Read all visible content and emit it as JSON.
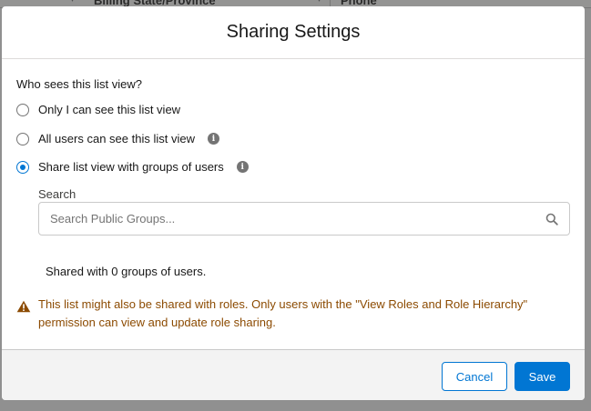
{
  "background": {
    "columns": [
      "Billing State/Province",
      "Phone"
    ]
  },
  "modal": {
    "title": "Sharing Settings",
    "question": "Who sees this list view?",
    "options": [
      {
        "label": "Only I can see this list view",
        "checked": false,
        "info": false
      },
      {
        "label": "All users can see this list view",
        "checked": false,
        "info": true
      },
      {
        "label": "Share list view with groups of users",
        "checked": true,
        "info": true
      }
    ],
    "search": {
      "label": "Search",
      "placeholder": "Search Public Groups..."
    },
    "shared_count": "Shared with 0 groups of users.",
    "warning": "This list might also be shared with roles. Only users with the \"View Roles and Role Hierarchy\" permission can view and update role sharing.",
    "footer": {
      "cancel_label": "Cancel",
      "save_label": "Save"
    }
  },
  "colors": {
    "brand": "#0176d3",
    "warning_text": "#8c4b02",
    "warning_icon": "#8c4b02"
  }
}
